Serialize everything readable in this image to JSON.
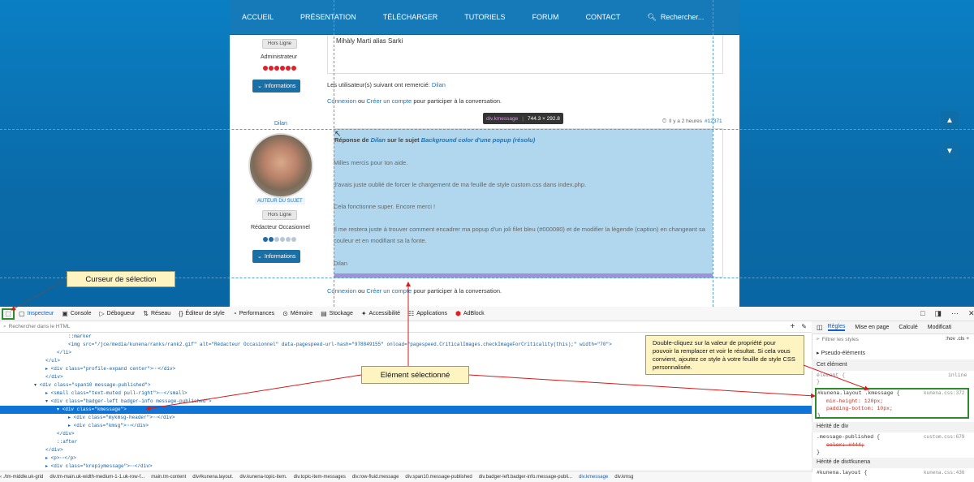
{
  "nav": {
    "items": [
      "ACCUEIL",
      "PRÉSENTATION",
      "TÉLÉCHARGER",
      "TUTORIELS",
      "FORUM",
      "CONTACT"
    ],
    "search_label": "Rechercher..."
  },
  "post1": {
    "offline": "Hors Ligne",
    "role": "Administrateur",
    "info_btn": "Informations",
    "signature": "Mihàly Marti alias Sarki",
    "thanks_prefix": "Les utilisateur(s) suivant ont remercié: ",
    "thanks_user": "Dilan",
    "login_link": "Connexion",
    "login_mid": " ou ",
    "register_link": "Créer un compte",
    "login_suffix": " pour participer à la conversation.",
    "time": "Il y a 2 heures",
    "anchor": "#12371"
  },
  "post2": {
    "username": "Dilan",
    "author_badge": "AUTEUR DU SUJET",
    "offline": "Hors Ligne",
    "role": "Rédacteur Occasionnel",
    "info_btn": "Informations",
    "header_prefix": "Réponse de ",
    "header_user": "Dilan",
    "header_mid": " sur le sujet ",
    "header_topic": "Background color d'une popup (résolu)",
    "paragraphs": [
      "Milles mercis pour ton aide.",
      "J'avais juste oublié de forcer le chargement de ma feuille de style custom.css dans index.php.",
      "Cela fonctionne super. Encore merci !",
      "Il me restera juste à trouver comment encadrer ma popup d'un joli filet bleu (#000080) et de modifier la légende (caption) en changeant sa couleur et en modifiant sa la fonte.",
      "Dilan"
    ],
    "login_link": "Connexion",
    "login_mid": " ou ",
    "register_link": "Créer un compte",
    "login_suffix": " pour participer à la conversation."
  },
  "tooltip": {
    "selector": "div.kmessage",
    "size": "744.3 × 292.8"
  },
  "callouts": {
    "cursor": "Curseur de sélection",
    "element": "Elément sélectionné",
    "hint": "Double-cliquez sur la valeur de propriété pour pouvoir la remplacer et voir le résultat. Si cela vous convient, ajoutez ce style à votre feuille de style CSS personnalisée."
  },
  "devtools": {
    "tabs": [
      "Inspecteur",
      "Console",
      "Débogueur",
      "Réseau",
      "Éditeur de style",
      "Performances",
      "Mémoire",
      "Stockage",
      "Accessibilité",
      "Applications",
      "AdBlock"
    ],
    "search_placeholder": "Rechercher dans le HTML",
    "html_lines": [
      {
        "indent": 12,
        "text": "::marker"
      },
      {
        "indent": 12,
        "text": "<img src=\"/jce/media/kunena/ranks/rank2.gif\" alt=\"Rédacteur Occasionnel\" data-pagespeed-url-hash=\"978849155\" onload=\"pagespeed.CriticalImages.checkImageForCriticality(this);\" width=\"70\">"
      },
      {
        "indent": 10,
        "text": "</li>"
      },
      {
        "indent": 8,
        "text": "</ul>"
      },
      {
        "indent": 8,
        "text": "▸ <div class=\"profile-expand center\">⋯</div>"
      },
      {
        "indent": 8,
        "text": "</div>"
      },
      {
        "indent": 6,
        "text": "▾ <div class=\"span10 message-published\">"
      },
      {
        "indent": 8,
        "text": "▸ <small class=\"text-muted pull-right\">⋯</small>"
      },
      {
        "indent": 8,
        "text": "▾ <div class=\"badger-left badger-info message-published\">"
      },
      {
        "indent": 10,
        "text": "▾ <div class=\"kmessage\">"
      },
      {
        "indent": 12,
        "text": "▸ <div class=\"mykmsg-header\">⋯</div>"
      },
      {
        "indent": 12,
        "text": "▸ <div class=\"kmsg\">⋯</div>"
      },
      {
        "indent": 10,
        "text": "</div>"
      },
      {
        "indent": 10,
        "text": "::after"
      },
      {
        "indent": 8,
        "text": "</div>"
      },
      {
        "indent": 8,
        "text": "▸ <p>⋯</p>"
      },
      {
        "indent": 8,
        "text": "▸ <div class=\"krepiymessage\">⋯</div>"
      }
    ],
    "rules_tabs": [
      "Règles",
      "Mise en page",
      "Calculé",
      "Modificati"
    ],
    "filter_placeholder": "Filtrer les styles",
    "filter_opts": ":hov  .cls  +",
    "pseudo": "Pseudo-éléments",
    "this_element": "Cet élément",
    "element_rule": "élément {",
    "inline": "inline",
    "rule_selector": "#kunena.layout .kmessage {",
    "rule_file": "kunena.css:372",
    "rule_props": [
      "min-height: 120px;",
      "padding-bottom: 10px;"
    ],
    "inherited1": "Hérité de div",
    "rule2_selector": ".message-published {",
    "rule2_file": "custom.css:679",
    "rule2_prop": "color: #444;",
    "inherited2": "Hérité de div#kunena",
    "rule3_selector": "#kunena.layout {",
    "rule3_file": "kunena.css:436",
    "breadcrumbs": [
      "‹ ./tm-middle.uk-grid",
      "div.tm-main.uk-width-medium-1-1.uk-row-f...",
      "main.tm-content",
      "div#kunena.layout.",
      "div.kunena-topic-item.",
      "div.topic-item-messages",
      "div.row-fluid.message",
      "div.span10.message-published",
      "div.badger-left.badger-info.message-publi...",
      "div.kmessage",
      "div.kmsg"
    ]
  },
  "colors": {
    "nav": "#1679b8",
    "highlight": "#70b6e0",
    "selected_row": "#0f74d6",
    "callout_bg": "#fdf4c2"
  }
}
